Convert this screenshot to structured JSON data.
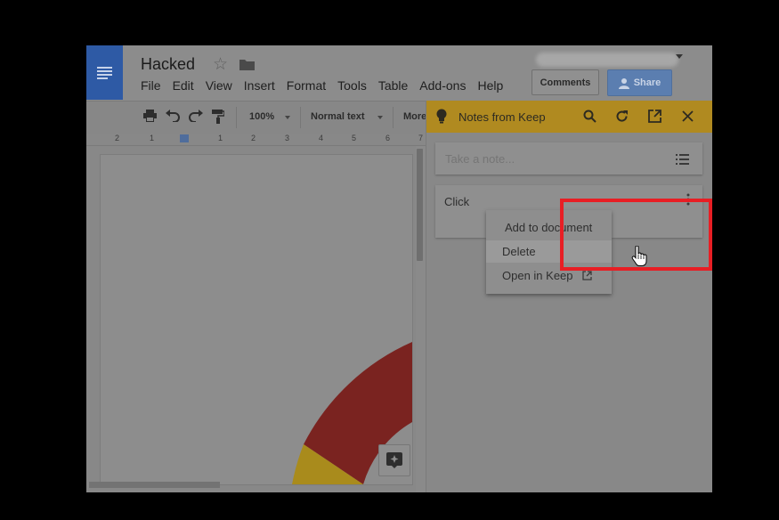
{
  "doc": {
    "title": "Hacked",
    "menu": [
      "File",
      "Edit",
      "View",
      "Insert",
      "Format",
      "Tools",
      "Table",
      "Add-ons",
      "Help"
    ],
    "comments_label": "Comments",
    "share_label": "Share"
  },
  "toolbar": {
    "zoom": "100%",
    "style": "Normal text",
    "more": "More"
  },
  "ruler": {
    "labels": [
      "2",
      "1",
      "1",
      "2",
      "3",
      "4",
      "5",
      "6",
      "7"
    ]
  },
  "keep": {
    "title": "Notes from Keep",
    "take_note_placeholder": "Take a note...",
    "note_text": "Click"
  },
  "context_menu": {
    "items": [
      "Add to document",
      "Delete",
      "Open in Keep"
    ]
  },
  "colors": {
    "docs_blue": "#2e5aa5",
    "keep_yellow": "#b08a20",
    "highlight_red": "#e81e24",
    "chart_red": "#7a2320",
    "chart_yellow": "#a98b1c"
  }
}
